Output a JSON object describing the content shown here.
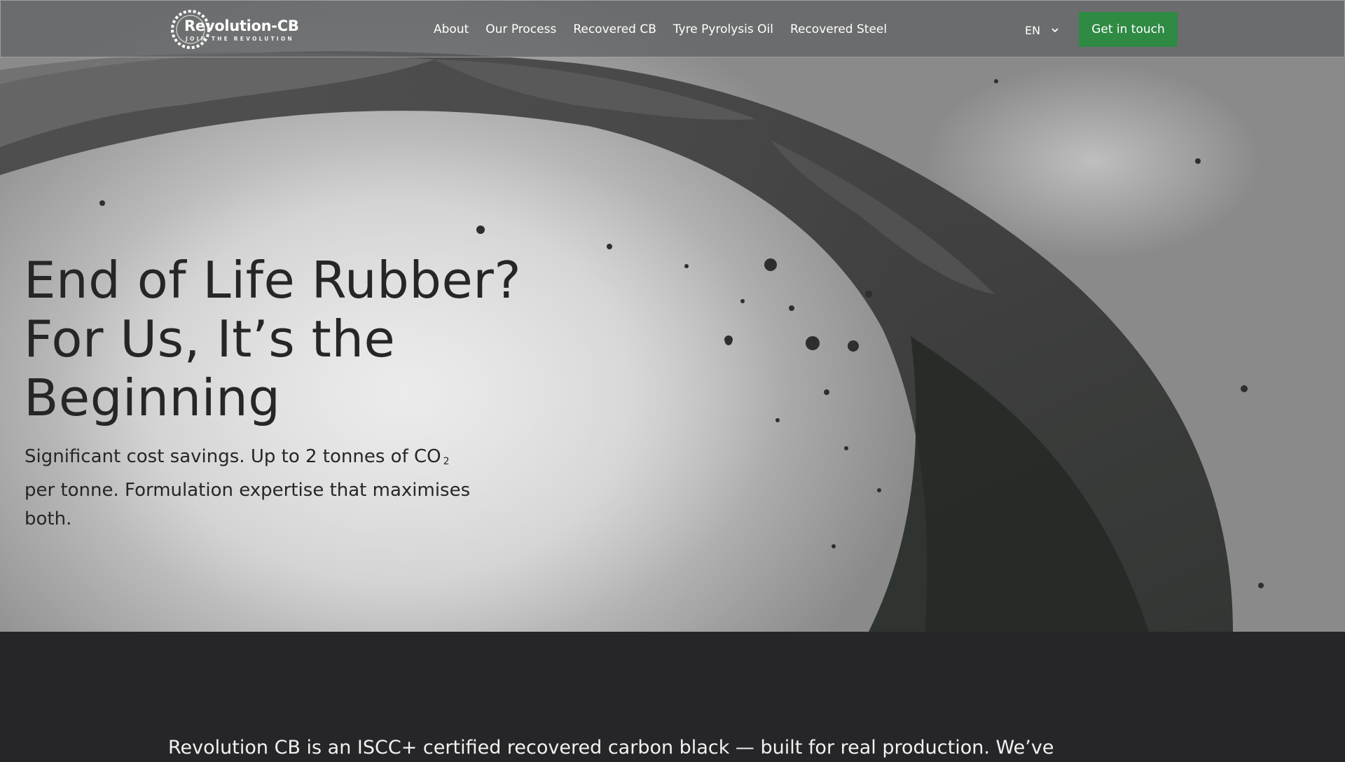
{
  "colors": {
    "accent_green": "#2f8a44",
    "nav_bg": "#5f6163",
    "dark_section": "#262628",
    "headline_text": "#262626"
  },
  "logo": {
    "name": "Revolution-CB",
    "tagline": "JOIN THE REVOLUTION",
    "icon": "tyre-ring-icon"
  },
  "nav": {
    "links": [
      "About",
      "Our Process",
      "Recovered CB",
      "Tyre Pyrolysis Oil",
      "Recovered Steel"
    ],
    "language": "EN",
    "language_icon": "chevron-down-icon",
    "cta_label": "Get in touch"
  },
  "hero": {
    "headline_lines": [
      "End of Life Rubber?",
      "For Us, It’s the",
      "Beginning"
    ],
    "subcopy_lines": [
      "Significant cost savings. Up to 2 tonnes of CO",
      "per tonne. Formulation expertise that maximises",
      "both."
    ],
    "subcopy_subscript": "2",
    "background_image": "crumbling-rubber-tyre-arc"
  },
  "intro": {
    "text": "Revolution CB is an ISCC+ certified recovered carbon black — built for real production. We’ve"
  }
}
